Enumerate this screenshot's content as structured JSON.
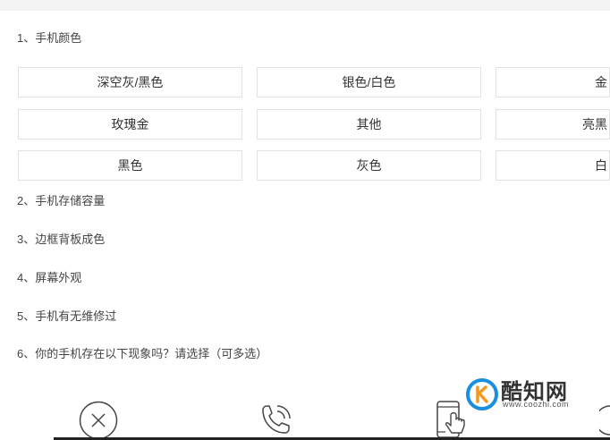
{
  "questions": [
    {
      "label": "1、手机颜色"
    },
    {
      "label": "2、手机存储容量"
    },
    {
      "label": "3、边框背板成色"
    },
    {
      "label": "4、屏幕外观"
    },
    {
      "label": "5、手机有无维修过"
    },
    {
      "label": "6、你的手机存在以下现象吗？请选择（可多选）"
    }
  ],
  "color_options": [
    [
      "深空灰/黑色",
      "银色/白色",
      "金"
    ],
    [
      "玫瑰金",
      "其他",
      "亮黑"
    ],
    [
      "黑色",
      "灰色",
      "白"
    ]
  ],
  "bottom_icons": [
    "close-circle-icon",
    "phone-call-icon",
    "touch-screen-icon",
    "partial-icon"
  ],
  "watermark": {
    "name": "酷知网",
    "url": "www.coozhi.com"
  }
}
